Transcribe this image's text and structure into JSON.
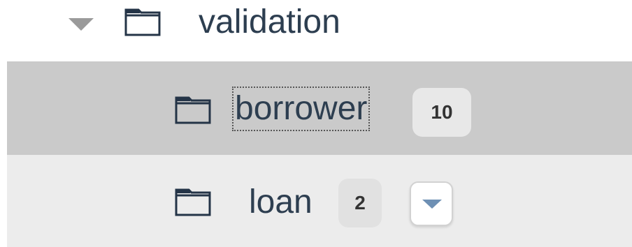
{
  "tree": {
    "parent": {
      "label": "validation",
      "expanded": true,
      "icon": "folder-icon",
      "toggle_icon": "caret-down-icon"
    },
    "children": [
      {
        "label": "borrower",
        "count": "10",
        "selected": true,
        "focused": true,
        "icon": "folder-icon"
      },
      {
        "label": "loan",
        "count": "2",
        "selected": false,
        "icon": "folder-icon",
        "menu_icon": "chevron-down-icon"
      }
    ]
  },
  "colors": {
    "selected_row_bg": "#cacaca",
    "hover_row_bg": "#ececec",
    "text": "#2d3e50",
    "folder_stroke": "#243447",
    "dropdown_arrow": "#6e90b4"
  }
}
